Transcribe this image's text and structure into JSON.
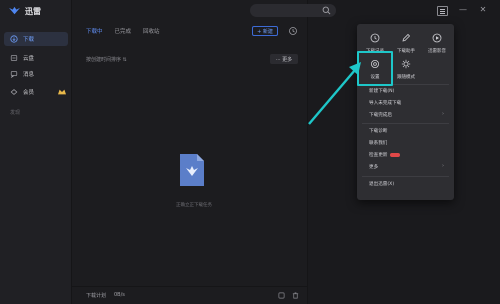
{
  "app": {
    "title": "迅雷"
  },
  "sidebar": {
    "items": [
      {
        "label": "下载",
        "icon": "download-icon",
        "active": true
      },
      {
        "label": "云盘",
        "icon": "cloud-icon",
        "active": false
      },
      {
        "label": "消息",
        "icon": "message-icon",
        "active": false
      },
      {
        "label": "会员",
        "icon": "vip-icon",
        "active": false
      }
    ],
    "section_label": "发现"
  },
  "main": {
    "tabs": [
      {
        "label": "下载中",
        "active": true
      },
      {
        "label": "已完成",
        "active": false
      },
      {
        "label": "回收站",
        "active": false
      }
    ],
    "new_button": "+ 新建",
    "sort_text": "按创建时间排序 ⇅",
    "more_button": "··· 更多",
    "empty_text": "正确立正下载任务",
    "footer": {
      "plan_label": "下载计划",
      "speed": "0B/s"
    }
  },
  "dropdown": {
    "grid": [
      {
        "label": "下载记录",
        "icon": "history-icon"
      },
      {
        "label": "下载助手",
        "icon": "pen-icon"
      },
      {
        "label": "迅雷影音",
        "icon": "video-icon"
      },
      {
        "label": "设置",
        "icon": "gear-icon"
      },
      {
        "label": "跟随模式",
        "icon": "sun-icon"
      }
    ],
    "items": [
      {
        "label": "新建下载(N)",
        "arrow": false
      },
      {
        "label": "导入未完成下载",
        "arrow": false
      },
      {
        "label": "下载完成后",
        "arrow": true
      },
      {
        "label": "下载诊断",
        "arrow": false
      },
      {
        "label": "联系我们",
        "arrow": false
      },
      {
        "label": "检查更新",
        "arrow": false,
        "badge": true
      },
      {
        "label": "更多",
        "arrow": true
      },
      {
        "label": "退出迅雷(X)",
        "arrow": false
      }
    ],
    "arrow_glyph": "›"
  },
  "window_controls": {
    "minimize": "—",
    "close": "✕"
  },
  "colors": {
    "accent": "#5f8cf0",
    "highlight": "#1ec7c9",
    "badge": "#e04848"
  }
}
